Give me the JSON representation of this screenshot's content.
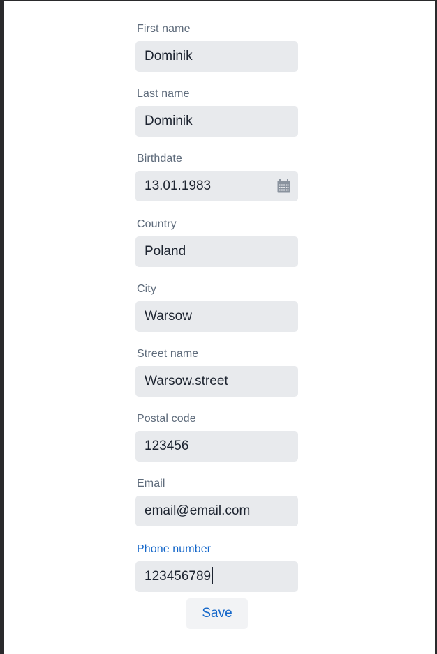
{
  "form": {
    "fields": [
      {
        "label": "First name",
        "value": "Dominik"
      },
      {
        "label": "Last name",
        "value": "Dominik"
      },
      {
        "label": "Birthdate",
        "value": "13.01.1983",
        "icon": "calendar-icon"
      },
      {
        "label": "Country",
        "value": "Poland"
      },
      {
        "label": "City",
        "value": "Warsow"
      },
      {
        "label": "Street name",
        "value": "Warsow.street"
      },
      {
        "label": "Postal code",
        "value": "123456"
      },
      {
        "label": "Email",
        "value": "email@email.com"
      },
      {
        "label": "Phone number",
        "value": "123456789",
        "focused": true
      }
    ],
    "save_label": "Save"
  },
  "colors": {
    "label": "#5e6b7b",
    "label_focused": "#1366c9",
    "input_bg": "#e8eaed",
    "text": "#1d2430",
    "button_text": "#1366c9",
    "button_bg": "#f2f3f5"
  }
}
